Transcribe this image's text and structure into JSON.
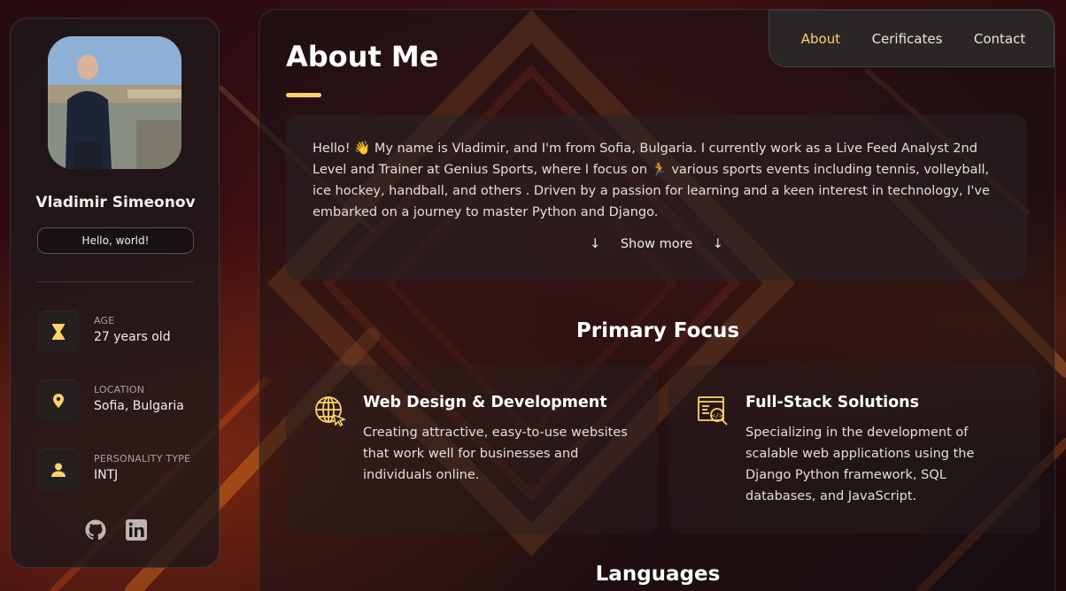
{
  "profile": {
    "name": "Vladimir Simeonov",
    "title": "Hello, world!",
    "info": [
      {
        "label": "AGE",
        "value": "27 years old",
        "icon": "hourglass-icon"
      },
      {
        "label": "LOCATION",
        "value": "Sofia, Bulgaria",
        "icon": "location-pin-icon"
      },
      {
        "label": "PERSONALITY TYPE",
        "value": "INTJ",
        "icon": "person-icon"
      }
    ],
    "socials": [
      {
        "name": "GitHub",
        "icon": "github-icon"
      },
      {
        "name": "LinkedIn",
        "icon": "linkedin-icon"
      }
    ]
  },
  "nav": {
    "items": [
      {
        "label": "About",
        "active": true
      },
      {
        "label": "Cerificates",
        "active": false
      },
      {
        "label": "Contact",
        "active": false
      }
    ]
  },
  "about": {
    "title": "About Me",
    "text": "Hello! 👋 My name is Vladimir, and I'm from Sofia, Bulgaria. I currently work as a Live Feed Analyst 2nd Level and Trainer at Genius Sports, where I focus on 🏃 various sports events including tennis, volleyball, ice hockey, handball, and others . Driven by a passion for learning and a keen interest in technology, I've embarked on a journey to master Python and Django.",
    "show_more": "Show more",
    "arrow": "↓"
  },
  "focus": {
    "title": "Primary Focus",
    "items": [
      {
        "title": "Web Design & Development",
        "text": "Creating attractive, easy-to-use websites that work well for businesses and individuals online.",
        "icon": "globe-cursor-icon"
      },
      {
        "title": "Full-Stack Solutions",
        "text": "Specializing in the development of scalable web applications using the Django Python framework, SQL databases, and JavaScript.",
        "icon": "code-search-icon"
      }
    ]
  },
  "languages": {
    "title": "Languages"
  },
  "colors": {
    "accent": "#ffd36b",
    "panel": "#2a2625"
  }
}
